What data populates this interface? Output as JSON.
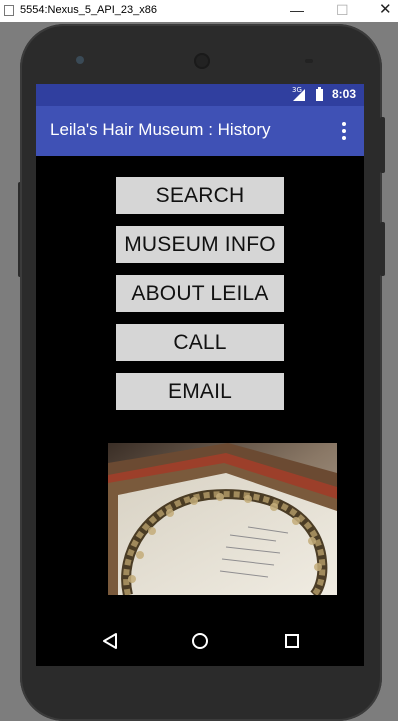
{
  "window": {
    "title": "5554:Nexus_5_API_23_x86",
    "minimize": "—",
    "maximize": "☐",
    "close": "✕"
  },
  "status_bar": {
    "network": "3G",
    "time": "8:03"
  },
  "app_bar": {
    "title": "Leila's Hair Museum : History",
    "overflow_icon": "more-vert-icon"
  },
  "buttons": {
    "search": "SEARCH",
    "museum_info": "MUSEUM INFO",
    "about": "ABOUT LEILA",
    "call": "CALL",
    "email": "EMAIL"
  },
  "navigation": {
    "back": "back-icon",
    "home": "home-icon",
    "recents": "recents-icon"
  },
  "colors": {
    "status_bar": "#303f9f",
    "app_bar": "#3f51b5",
    "button": "#d6d6d6",
    "screen_bg": "#000000"
  }
}
